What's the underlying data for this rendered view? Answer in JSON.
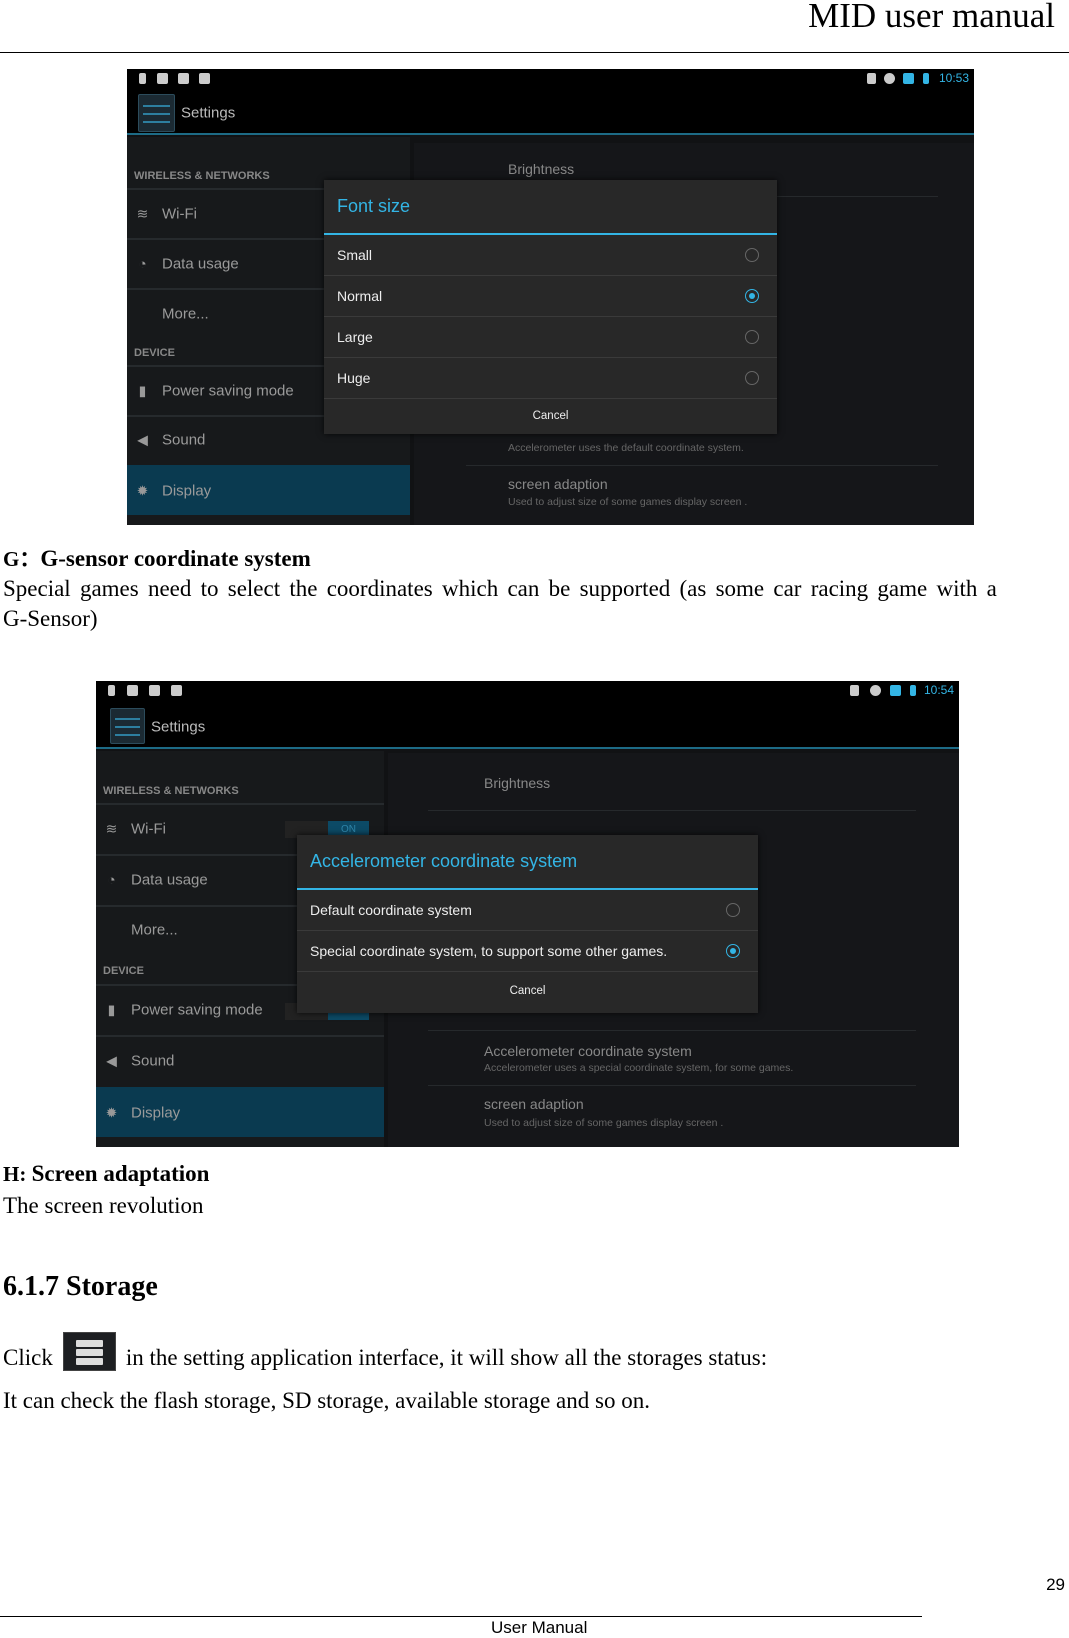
{
  "header": {
    "title": "MID user manual"
  },
  "screenshot1": {
    "time": "10:53",
    "app_title": "Settings",
    "left": {
      "cat_wireless": "WIRELESS & NETWORKS",
      "wifi": "Wi-Fi",
      "data_usage": "Data usage",
      "more": "More...",
      "cat_device": "DEVICE",
      "power": "Power saving mode",
      "sound": "Sound",
      "display": "Display"
    },
    "right": {
      "brightness": "Brightness",
      "accel_sub": "Accelerometer uses the default coordinate system.",
      "screen_adaption": "screen adaption",
      "screen_sub": "Used to adjust size of some games display screen ."
    },
    "dialog": {
      "title": "Font size",
      "options": [
        {
          "label": "Small",
          "selected": false
        },
        {
          "label": "Normal",
          "selected": true
        },
        {
          "label": "Large",
          "selected": false
        },
        {
          "label": "Huge",
          "selected": false
        }
      ],
      "cancel": "Cancel"
    }
  },
  "section_g": {
    "prefix": "G：",
    "title": "G-sensor coordinate system",
    "line1": "Special games need to select the coordinates which can be supported (as some car racing game with a",
    "line2": "G-Sensor)"
  },
  "screenshot2": {
    "time": "10:54",
    "app_title": "Settings",
    "left": {
      "cat_wireless": "WIRELESS & NETWORKS",
      "wifi": "Wi-Fi",
      "wifi_toggle": "ON",
      "data_usage": "Data usage",
      "more": "More...",
      "cat_device": "DEVICE",
      "power": "Power saving mode",
      "sound": "Sound",
      "display": "Display"
    },
    "right": {
      "brightness": "Brightness",
      "accel_title": "Accelerometer coordinate system",
      "accel_sub": "Accelerometer uses a special coordinate system, for some games.",
      "screen_adaption": "screen adaption",
      "screen_sub": "Used to adjust size of some games display screen ."
    },
    "dialog": {
      "title": "Accelerometer coordinate system",
      "options": [
        {
          "label": "Default coordinate system",
          "selected": false
        },
        {
          "label": "Special coordinate system, to support some other games.",
          "selected": true
        }
      ],
      "cancel": "Cancel"
    }
  },
  "section_h": {
    "prefix": "H: ",
    "title": "Screen adaptation",
    "text": "The screen revolution"
  },
  "storage": {
    "heading": "6.1.7 Storage",
    "click": "Click",
    "line1_rest": "in the setting application interface, it will show all the storages status:",
    "line2": "It can check the flash storage, SD storage, available storage and so on."
  },
  "footer": {
    "page_number": "29",
    "label": "User Manual"
  },
  "colors": {
    "accent": "#33b5e5",
    "highlight": "#0a3a50"
  }
}
